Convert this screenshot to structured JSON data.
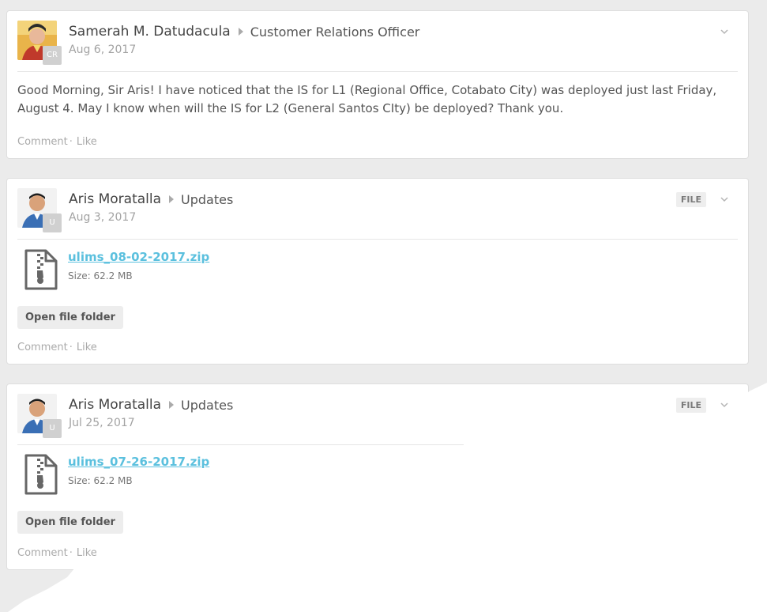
{
  "colors": {
    "page_background": "#ebebeb",
    "card_background": "#ffffff",
    "link": "#5bc0de",
    "muted_text": "#a3a3a3"
  },
  "posts": [
    {
      "author": "Samerah M. Datudacula",
      "target": "Customer Relations Officer",
      "date": "Aug 6, 2017",
      "avatar_badge": "CR",
      "message": "Good Morning, Sir Aris! I have noticed that the IS for L1 (Regional Office, Cotabato City) was deployed just last Friday, August 4. May I know when will the IS for L2 (General Santos CIty) be deployed? Thank you.",
      "actions": {
        "comment": "Comment",
        "separator": "·",
        "like": "Like"
      }
    },
    {
      "author": "Aris Moratalla",
      "target": "Updates",
      "date": "Aug 3, 2017",
      "avatar_badge": "U",
      "tag": "FILE",
      "file": {
        "name": "ulims_08-02-2017.zip",
        "size": "Size: 62.2 MB",
        "icon": "zip-file-icon"
      },
      "button": "Open file folder",
      "actions": {
        "comment": "Comment",
        "separator": "·",
        "like": "Like"
      }
    },
    {
      "author": "Aris Moratalla",
      "target": "Updates",
      "date": "Jul 25, 2017",
      "avatar_badge": "U",
      "tag": "FILE",
      "file": {
        "name": "ulims_07-26-2017.zip",
        "size": "Size: 62.2 MB",
        "icon": "zip-file-icon"
      },
      "button": "Open file folder",
      "actions": {
        "comment": "Comment",
        "separator": "·",
        "like": "Like"
      }
    }
  ]
}
